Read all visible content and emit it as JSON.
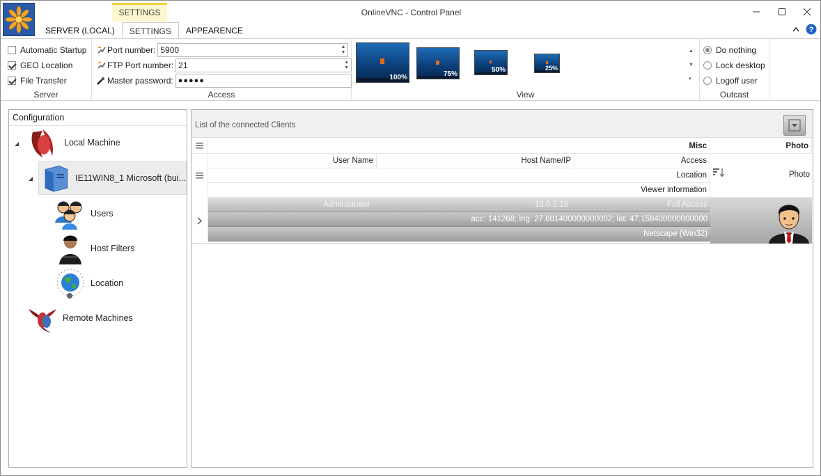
{
  "window": {
    "title": "OnlineVNC - Control Panel",
    "contextual_tab": "SETTINGS"
  },
  "tabs": [
    {
      "label": "SERVER (LOCAL)"
    },
    {
      "label": "SETTINGS"
    },
    {
      "label": "APPEARENCE"
    }
  ],
  "ribbon": {
    "server": {
      "group_label": "Server",
      "options": [
        {
          "label": "Automatic Startup",
          "checked": false
        },
        {
          "label": "GEO Location",
          "checked": true
        },
        {
          "label": "File Transfer",
          "checked": true
        }
      ]
    },
    "access": {
      "group_label": "Access",
      "port": {
        "label": "Port number:",
        "value": "5900"
      },
      "ftp_port": {
        "label": "FTP Port number:",
        "value": "21"
      },
      "password": {
        "label": "Master password:",
        "value": "●●●●●"
      }
    },
    "view": {
      "group_label": "View",
      "thumbnails": [
        {
          "label": "100%"
        },
        {
          "label": "75%"
        },
        {
          "label": "50%"
        },
        {
          "label": "25%"
        }
      ]
    },
    "outcast": {
      "group_label": "Outcast",
      "options": [
        {
          "label": "Do nothing",
          "selected": true
        },
        {
          "label": "Lock desktop",
          "selected": false
        },
        {
          "label": "Logoff user",
          "selected": false
        }
      ]
    }
  },
  "tree": {
    "header": "Configuration",
    "local_machine": "Local Machine",
    "computer": "IE11WIN8_1 Microsoft  (bui...",
    "users": "Users",
    "host_filters": "Host Filters",
    "location": "Location",
    "remote_machines": "Remote Machines"
  },
  "clients": {
    "caption": "List of the connected Clients",
    "band_misc": "Misc",
    "band_photo": "Photo",
    "col_user": "User Name",
    "col_host": "Host Name/IP",
    "col_access": "Access",
    "col_location": "Location",
    "col_viewer": "Viewer information",
    "col_photo": "Photo",
    "rows": [
      {
        "user": "Administrator",
        "host": "10.0.2.15",
        "access": "Full Access",
        "location": "acc: 141268; lng: 27.601400000000002; lat: 47.158400000000000",
        "viewer": "Netscape (Win32)"
      }
    ]
  },
  "colors": {
    "accent_yellow": "#f3d33b",
    "ribbon_bg": "#ffffff",
    "row_grey": "#a8a8a8"
  }
}
